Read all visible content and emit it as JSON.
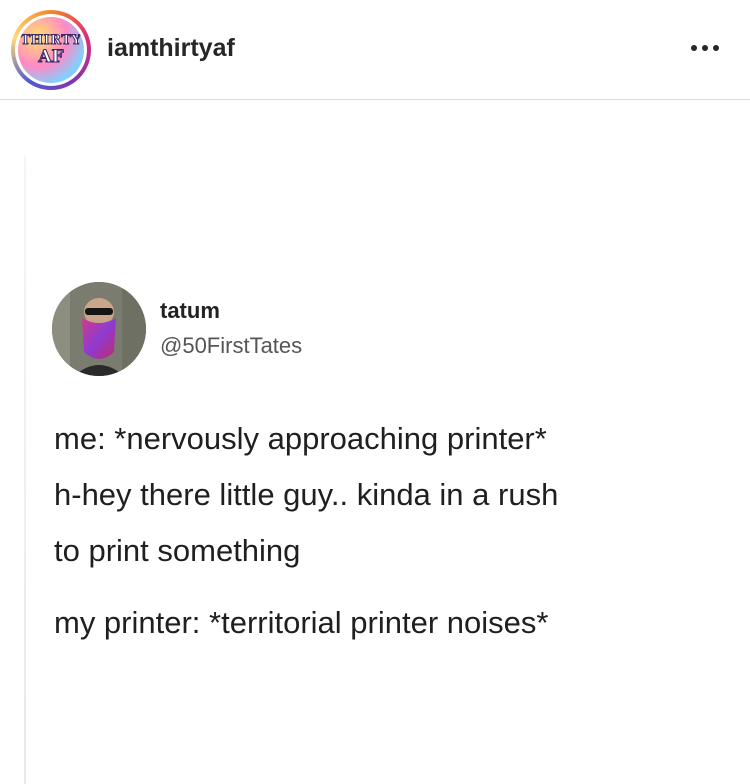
{
  "header": {
    "username": "iamthirtyaf",
    "logo_line1": "THIRTY",
    "logo_line2": "AF"
  },
  "tweet": {
    "name": "tatum",
    "handle": "@50FirstTates",
    "lines": [
      "me: *nervously approaching printer*",
      "h-hey there little guy.. kinda in a rush",
      "to print something",
      "my printer: *territorial printer noises*"
    ]
  }
}
